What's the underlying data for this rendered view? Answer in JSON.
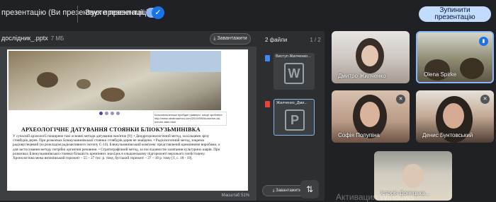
{
  "topbar": {
    "presenting_text": "презентацію (Ви презентуєте презентацію))",
    "sound_label": "Звук презентації",
    "sound_enabled": true,
    "stop_button_line1": "Зупинити",
    "stop_button_line2": "презентацію"
  },
  "document": {
    "title": "дослідник_.pptx",
    "size": "7 МБ",
    "download_label": "Завантажити",
    "zoom_label": "Масштаб 51%",
    "slide": {
      "caption": "Білоскельненські пробідні гравюри. місце зроблене http://www.ukrainaarheo.com/2019/09/bilozkelne-aa-hrechn-tabri.html",
      "heading": "АРХЕОЛОГІЧНЕ ДАТУВАННЯ СТОЯНКИ БЛІОКУЗЬМИНІВКА",
      "body": "У сучасній археології поширено такі основні методи датування пам'яток [9]: • Дендрохронологічний метод, за кільцями зрізу стовбурів дерев. При розкопках Блюкузьминівської стоянки стовбурів дерев не знайдено. • Радіоізотопний метод, зокрема радіовуглецевий (за розкладом радіоактивного ізотопу С-14). Блюкузьминівський комплекс представлений кремінними виробами, а для застосування методу потрібні органічні речовини. • Стратиграфічний метод, за послідовністю залягання культурних шарів. При розкопках Блюкузьминівської стоянки більшість кремінних знахідок в ольшанському підгоризонті верхнього плейстоцену. Хронологічна межа витачівський горизонт – 55 – 27 тис. р. тому, бугський горизонт – 27 – 18 р. тому [1, с. 18 - 19]."
    }
  },
  "files_panel": {
    "header": "2 файли",
    "count": "1 / 2",
    "files": [
      {
        "name": "Виступ Жилченко...",
        "letter": "W",
        "icon": "word-icon"
      },
      {
        "name": "Жилченко_Дми...",
        "letter": "P",
        "icon": "powerpoint-icon"
      }
    ],
    "download_label": "Завантажити"
  },
  "participants": [
    {
      "name": "Дмитро Жилченко",
      "mic": "none"
    },
    {
      "name": "Olena Spirke",
      "mic": "speaking"
    },
    {
      "name": "Софія Полупіна",
      "mic": "muted"
    },
    {
      "name": "Денис Бунтовський",
      "mic": "muted"
    },
    {
      "name": "Історія Донецька...",
      "mic": "none"
    }
  ],
  "watermark": "Активация Windows",
  "colors": {
    "accent": "#8ab4f8",
    "stop_button": "#c2dbff",
    "background": "#202124"
  }
}
